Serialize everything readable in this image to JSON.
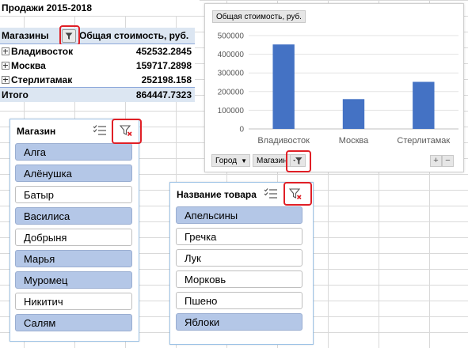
{
  "pivot": {
    "title": "Продажи 2015-2018",
    "row_header": "Магазины",
    "value_header": "Общая стоимость, руб.",
    "rows": [
      {
        "name": "Владивосток",
        "value": "452532.2845"
      },
      {
        "name": "Москва",
        "value": "159717.2898"
      },
      {
        "name": "Стерлитамак",
        "value": "252198.158"
      }
    ],
    "total_label": "Итого",
    "total_value": "864447.7323"
  },
  "chart": {
    "field_button": "Общая стоимость, руб.",
    "axis_fields": [
      "Город",
      "Магазин"
    ],
    "plus": "+",
    "minus": "−"
  },
  "chart_data": {
    "type": "bar",
    "title": "",
    "categories": [
      "Владивосток",
      "Москва",
      "Стерлитамак"
    ],
    "values": [
      452532.2845,
      159717.2898,
      252198.158
    ],
    "ylim": [
      0,
      500000
    ],
    "yticks": [
      0,
      100000,
      200000,
      300000,
      400000,
      500000
    ],
    "grid": true,
    "bar_color": "#4472c4"
  },
  "slicer_store": {
    "header": "Магазин",
    "items": [
      {
        "label": "Алга",
        "selected": true
      },
      {
        "label": "Алёнушка",
        "selected": true
      },
      {
        "label": "Батыр",
        "selected": false
      },
      {
        "label": "Василиса",
        "selected": true
      },
      {
        "label": "Добрыня",
        "selected": false
      },
      {
        "label": "Марья",
        "selected": true
      },
      {
        "label": "Муромец",
        "selected": true
      },
      {
        "label": "Никитич",
        "selected": false
      },
      {
        "label": "Салям",
        "selected": true
      }
    ]
  },
  "slicer_product": {
    "header": "Название товара",
    "items": [
      {
        "label": "Апельсины",
        "selected": true
      },
      {
        "label": "Гречка",
        "selected": false
      },
      {
        "label": "Лук",
        "selected": false
      },
      {
        "label": "Морковь",
        "selected": false
      },
      {
        "label": "Пшено",
        "selected": false
      },
      {
        "label": "Яблоки",
        "selected": true
      }
    ]
  },
  "colors": {
    "highlight": "#e01f26",
    "selected_item": "#b4c7e7",
    "header_fill": "#dce6f2"
  },
  "icons": {
    "filter": "filter-icon",
    "clear_filter": "clear-filter-icon",
    "multiselect": "multi-select-icon"
  }
}
